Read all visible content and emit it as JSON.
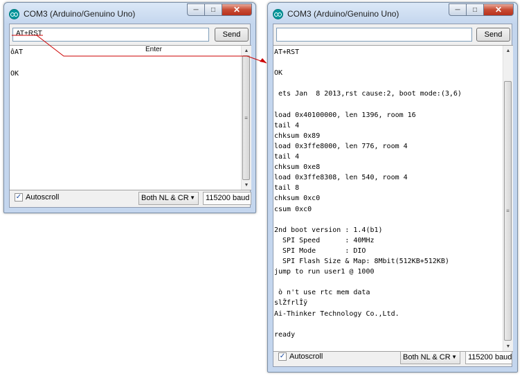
{
  "left_window": {
    "title": "COM3 (Arduino/Genuino Uno)",
    "input_value": "AT+RST",
    "send_label": "Send",
    "output_lines": [
      "ôAT",
      "",
      "OK"
    ],
    "autoscroll_label": "Autoscroll",
    "autoscroll_checked": true,
    "line_ending": "Both NL & CR",
    "baud": "115200 baud"
  },
  "right_window": {
    "title": "COM3 (Arduino/Genuino Uno)",
    "input_value": "",
    "send_label": "Send",
    "output_lines": [
      "AT+RST",
      "",
      "OK",
      "",
      " ets Jan  8 2013,rst cause:2, boot mode:(3,6)",
      "",
      "load 0x40100000, len 1396, room 16",
      "tail 4",
      "chksum 0x89",
      "load 0x3ffe8000, len 776, room 4",
      "tail 4",
      "chksum 0xe8",
      "load 0x3ffe8308, len 540, room 4",
      "tail 8",
      "chksum 0xc0",
      "csum 0xc0",
      "",
      "2nd boot version : 1.4(b1)",
      "  SPI Speed      : 40MHz",
      "  SPI Mode       : DIO",
      "  SPI Flash Size & Map: 8Mbit(512KB+512KB)",
      "jump to run user1 @ 1000",
      "",
      " ò n't use rtc mem data",
      "slŽfrlÎÿ",
      "Ai-Thinker Technology Co.,Ltd.",
      "",
      "ready"
    ],
    "autoscroll_label": "Autoscroll",
    "autoscroll_checked": true,
    "line_ending": "Both NL & CR",
    "baud": "115200 baud"
  },
  "annotation": {
    "enter_label": "Enter",
    "color": "#cc0000"
  }
}
